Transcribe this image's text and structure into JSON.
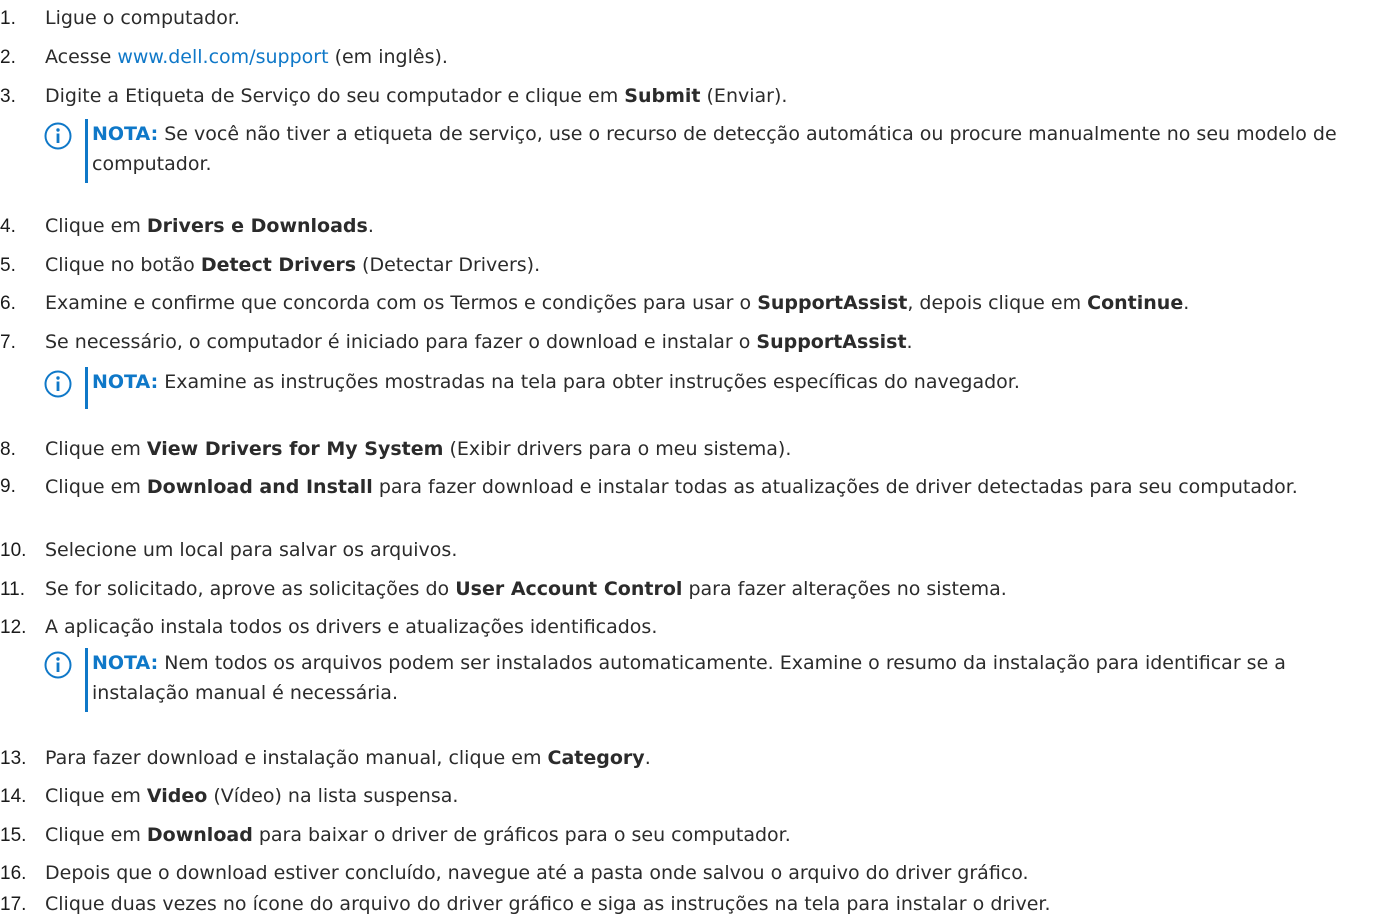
{
  "steps": [
    {
      "num": "1.",
      "before": "Ligue o computador."
    },
    {
      "num": "2.",
      "before": "Acesse ",
      "link": "www.dell.com/support",
      "after": " (em inglês)."
    },
    {
      "num": "3.",
      "before": "Digite a Etiqueta de Serviço do seu computador e clique em ",
      "bold": "Submit",
      "after": " (Enviar)."
    },
    {
      "num": "4.",
      "before": "Clique em ",
      "bold": "Drivers e Downloads",
      "after": "."
    },
    {
      "num": "5.",
      "before": "Clique no botão ",
      "bold": "Detect Drivers",
      "after": " (Detectar Drivers)."
    },
    {
      "num": "6.",
      "before": "Examine e confirme que concorda com os Termos e condições para usar o ",
      "bold": "SupportAssist",
      "middle": ", depois clique em ",
      "bold2": "Continue",
      "after": "."
    },
    {
      "num": "7.",
      "before": "Se necessário, o computador é iniciado para fazer o download e instalar o ",
      "bold": "SupportAssist",
      "after": "."
    },
    {
      "num": "8.",
      "before": "Clique em ",
      "bold": "View Drivers for My System",
      "after": " (Exibir drivers para o meu sistema)."
    },
    {
      "num": "9.",
      "before": "Clique em ",
      "bold": "Download and Install",
      "after": " para fazer download e instalar todas as atualizações de driver detectadas para seu computador."
    },
    {
      "num": "10.",
      "before": "Selecione um local para salvar os arquivos."
    },
    {
      "num": "11.",
      "before": "Se for solicitado, aprove as solicitações do ",
      "bold": "User Account Control",
      "after": " para fazer alterações no sistema."
    },
    {
      "num": "12.",
      "before": "A aplicação instala todos os drivers e atualizações identificados."
    },
    {
      "num": "13.",
      "before": "Para fazer download e instalação manual, clique em ",
      "bold": "Category",
      "after": "."
    },
    {
      "num": "14.",
      "before": "Clique em ",
      "bold": "Video",
      "after": " (Vídeo) na lista suspensa."
    },
    {
      "num": "15.",
      "before": "Clique em ",
      "bold": "Download",
      "after": " para baixar o driver de gráficos para o seu computador."
    },
    {
      "num": "16.",
      "before": "Depois que o download estiver concluído, navegue até a pasta onde salvou o arquivo do driver gráfico."
    },
    {
      "num": "17.",
      "before": "Clique duas vezes no ícone do arquivo do driver gráfico e siga as instruções na tela para instalar o driver."
    }
  ],
  "notes": [
    {
      "label": "NOTA:",
      "text": " Se você não tiver a etiqueta de serviço, use o recurso de detecção automática ou procure manualmente no seu modelo de computador.",
      "icon": "info-icon"
    },
    {
      "label": "NOTA:",
      "text": " Examine as instruções mostradas na tela para obter instruções específicas do navegador.",
      "icon": "info-icon"
    },
    {
      "label": "NOTA:",
      "text": " Nem todos os arquivos podem ser instalados automaticamente. Examine o resumo da instalação para identificar se a instalação manual é necessária.",
      "icon": "info-icon"
    }
  ],
  "colors": {
    "accent": "#0f78c8",
    "text": "#2b2b2b"
  }
}
